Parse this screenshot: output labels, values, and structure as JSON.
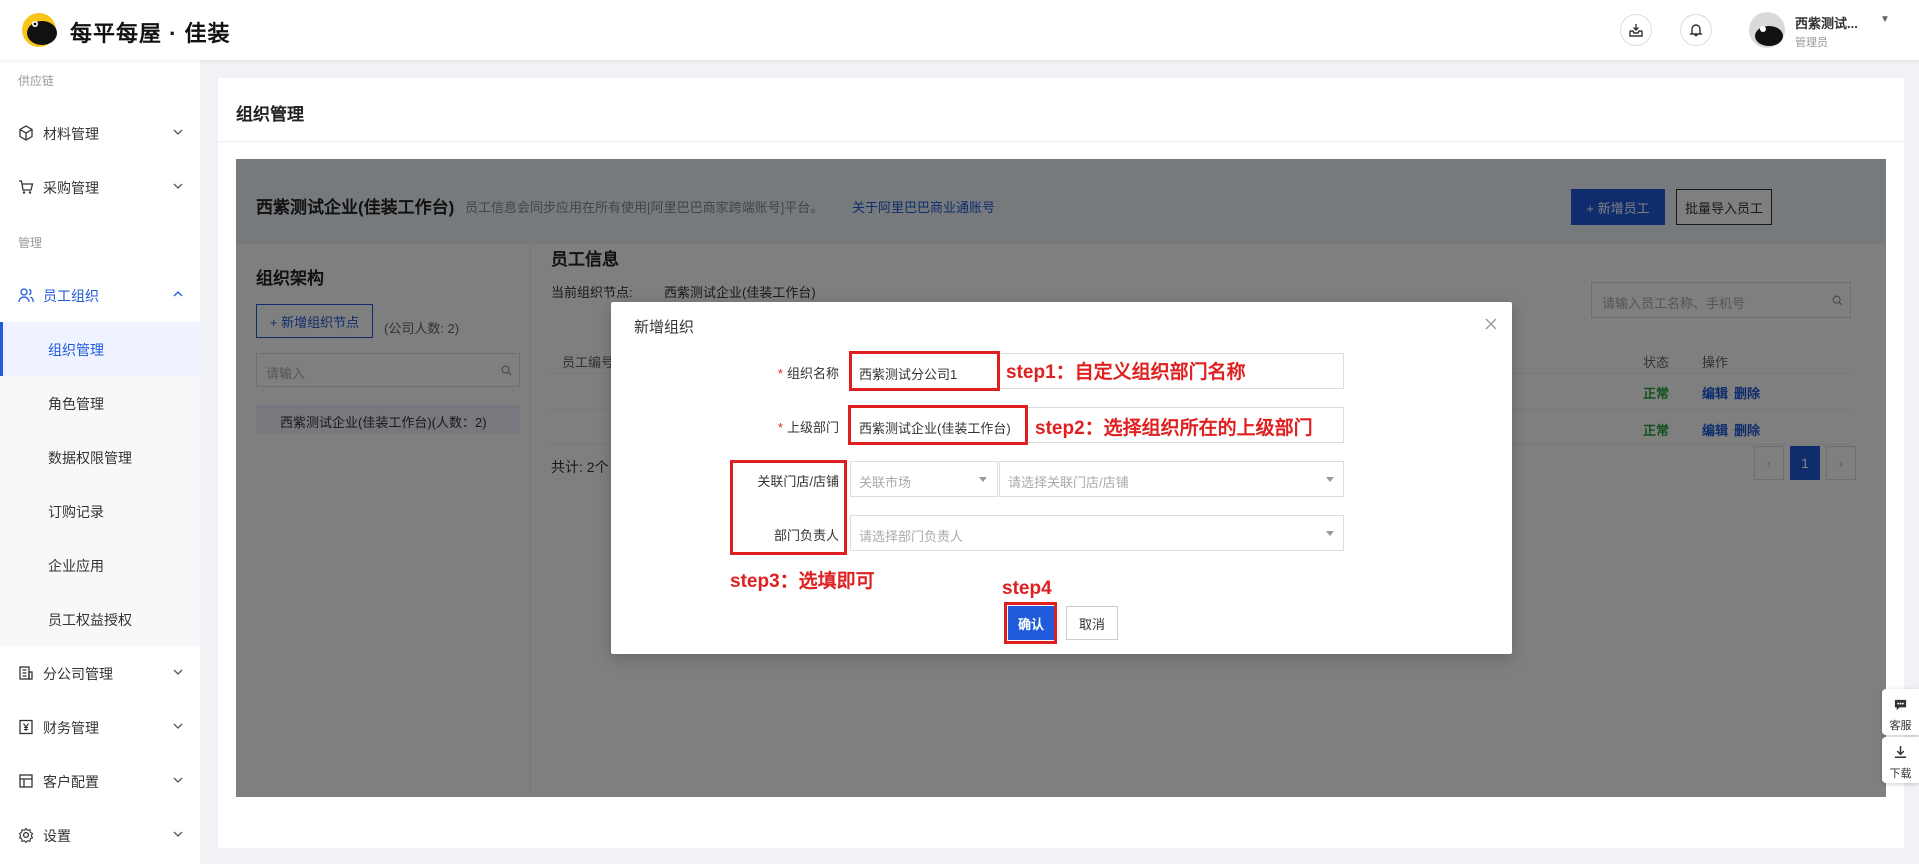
{
  "header": {
    "brand": "每平每屋 · 佳装",
    "user_name": "西紫测试...",
    "user_role": "管理员"
  },
  "sidebar": {
    "group_supply": "供应链",
    "group_manage": "管理",
    "materials": "材料管理",
    "purchase": "采购管理",
    "staff_org": "员工组织",
    "sub_items": [
      "组织管理",
      "角色管理",
      "数据权限管理",
      "订购记录",
      "企业应用",
      "员工权益授权"
    ],
    "branch": "分公司管理",
    "finance": "财务管理",
    "customer": "客户配置",
    "settings": "设置"
  },
  "main": {
    "title": "组织管理",
    "company": "西紫测试企业(佳装工作台)",
    "banner_tip": "员工信息会同步应用在所有使用[阿里巴巴商家跨端账号]平台。",
    "banner_link": "关于阿里巴巴商业通账号",
    "add_staff": "+ 新增员工",
    "import_staff": "批量导入员工",
    "org_title": "组织架构",
    "add_node": "+ 新增组织节点",
    "company_count": "(公司人数: 2)",
    "org_search_placeholder": "请输入",
    "org_node": "西紫测试企业(佳装工作台)(人数：2)",
    "emp_title": "员工信息",
    "current_node_label": "当前组织节点:",
    "current_node_value": "西紫测试企业(佳装工作台)",
    "emp_search_placeholder": "请输入员工名称、手机号",
    "col_emp_no": "员工编号",
    "col_status": "状态",
    "col_action": "操作",
    "rows": [
      {
        "status": "正常",
        "edit": "编辑",
        "delete": "删除"
      },
      {
        "status": "正常",
        "edit": "编辑",
        "delete": "删除"
      }
    ],
    "total": "共计: 2个",
    "page_current": "1",
    "page_prev": "‹",
    "page_next": "›"
  },
  "modal": {
    "title": "新增组织",
    "org_name_label": "组织名称",
    "org_name_value": "西紫测试分公司1",
    "parent_label": "上级部门",
    "parent_value": "西紫测试企业(佳装工作台)",
    "store_label": "关联门店/店铺",
    "market_placeholder": "关联市场",
    "store_placeholder": "请选择关联门店/店铺",
    "leader_label": "部门负责人",
    "leader_placeholder": "请选择部门负责人",
    "confirm": "确认",
    "cancel": "取消"
  },
  "annotations": {
    "step1": "step1：自定义组织部门名称",
    "step2": "step2：选择组织所在的上级部门",
    "step3": "step3：选填即可",
    "step4": "step4"
  },
  "float": {
    "service": "客服",
    "download": "下载"
  },
  "colors": {
    "primary": "#1f5bdb",
    "annotation_red": "#e02020",
    "status_green": "#22a33a"
  }
}
